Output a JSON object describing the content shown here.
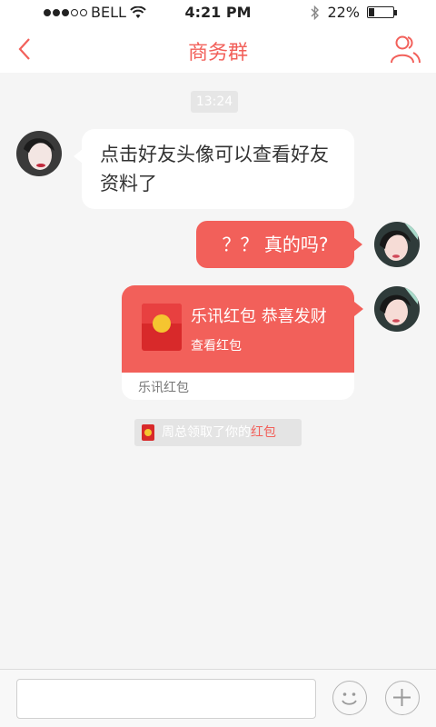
{
  "status_bar": {
    "carrier": "BELL",
    "time": "4:21 PM",
    "battery": "22%",
    "battery_level": 0.22,
    "signal_bars": 3,
    "signal_total": 5
  },
  "nav": {
    "title": "商务群",
    "back_icon": "chevron-left-icon",
    "members_icon": "group-members-icon"
  },
  "chat": {
    "timestamp": "13:24",
    "messages": [
      {
        "side": "left",
        "text": "点击好友头像可以查看好友资料了"
      },
      {
        "side": "right",
        "text": "？？ 真的吗?"
      }
    ],
    "red_packet": {
      "title": "乐讯红包 恭喜发财",
      "action": "查看红包",
      "footer": "乐讯红包"
    },
    "notice": {
      "prefix": "周总领取了你的",
      "highlight": "红包"
    }
  },
  "input_bar": {
    "placeholder": "",
    "emoji_icon": "smiley-icon",
    "plus_icon": "plus-icon"
  },
  "colors": {
    "accent": "#f2605a",
    "envelope": "#d8292a",
    "coin": "#f5c530",
    "background": "#f5f5f5"
  }
}
